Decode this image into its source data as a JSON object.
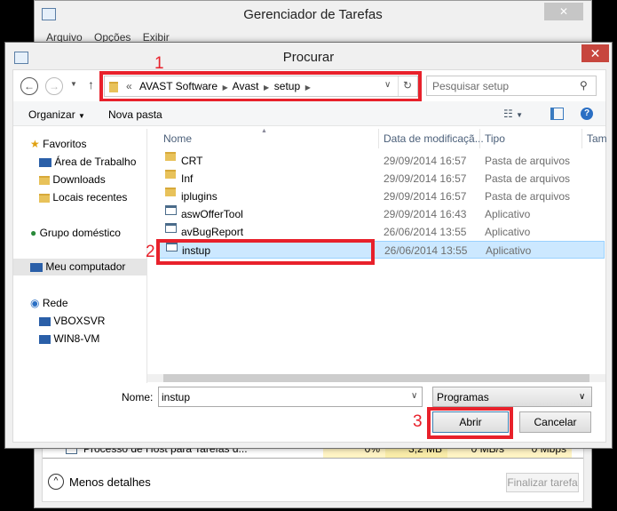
{
  "task_manager": {
    "title": "Gerenciador de Tarefas",
    "menu": [
      "Arquivo",
      "Opções",
      "Exibir"
    ],
    "process_row": {
      "name": "Processo de Host para Tarefas d...",
      "cpu": "0%",
      "memory": "3,2 MB",
      "disk": "0 MB/s",
      "network": "0 Mbps"
    },
    "less_details": "Menos detalhes",
    "end_task": "Finalizar tarefa"
  },
  "dialog": {
    "title": "Procurar",
    "close": "✕",
    "breadcrumb": [
      "«",
      "AVAST Software",
      "Avast",
      "setup"
    ],
    "search_placeholder": "Pesquisar setup",
    "toolbar": {
      "organize": "Organizar",
      "new_folder": "Nova pasta"
    },
    "nav": {
      "favorites": "Favoritos",
      "desktop": "Área de Trabalho",
      "downloads": "Downloads",
      "recent": "Locais recentes",
      "homegroup": "Grupo doméstico",
      "computer": "Meu computador",
      "network": "Rede",
      "net_items": [
        "VBOXSVR",
        "WIN8-VM"
      ]
    },
    "columns": {
      "name": "Nome",
      "date": "Data de modificaçã...",
      "type": "Tipo",
      "size": "Tam"
    },
    "files": [
      {
        "name": "CRT",
        "date": "29/09/2014 16:57",
        "type": "Pasta de arquivos",
        "icon": "folder"
      },
      {
        "name": "Inf",
        "date": "29/09/2014 16:57",
        "type": "Pasta de arquivos",
        "icon": "folder"
      },
      {
        "name": "iplugins",
        "date": "29/09/2014 16:57",
        "type": "Pasta de arquivos",
        "icon": "folder"
      },
      {
        "name": "aswOfferTool",
        "date": "29/09/2014 16:43",
        "type": "Aplicativo",
        "icon": "app"
      },
      {
        "name": "avBugReport",
        "date": "26/06/2014 13:55",
        "type": "Aplicativo",
        "icon": "app"
      },
      {
        "name": "instup",
        "date": "26/06/2014 13:55",
        "type": "Aplicativo",
        "icon": "app",
        "selected": true
      }
    ],
    "filename_label": "Nome:",
    "filename_value": "instup",
    "filetype": "Programas",
    "open": "Abrir",
    "cancel": "Cancelar"
  },
  "annotations": [
    "1",
    "2",
    "3"
  ],
  "colors": {
    "highlight": "#e8212b",
    "selection": "#cce8ff",
    "close": "#c7463e"
  }
}
